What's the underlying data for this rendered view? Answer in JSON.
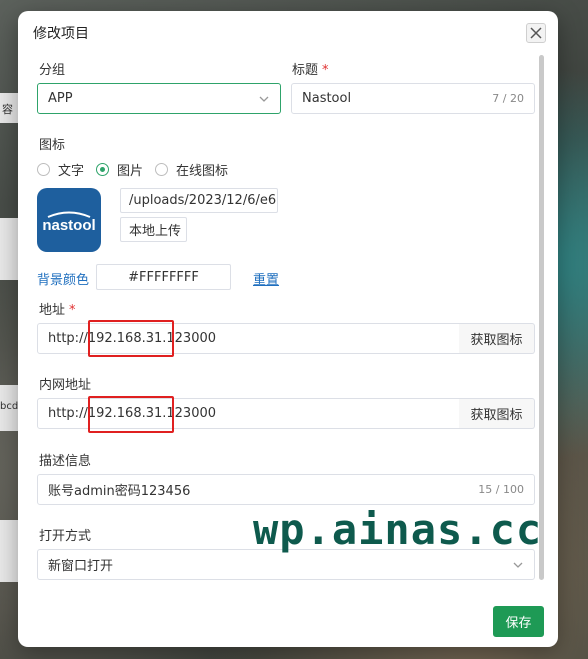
{
  "background": {
    "strip_top_text": "容",
    "strip_mid_text": "bcd"
  },
  "dialog": {
    "title": "修改项目",
    "close_icon": "close-icon"
  },
  "group": {
    "label": "分组",
    "value": "APP"
  },
  "title_field": {
    "label": "标题",
    "required_mark": "*",
    "value": "Nastool",
    "counter": "7 / 20"
  },
  "icon": {
    "label": "图标",
    "options": [
      "文字",
      "图片",
      "在线图标"
    ],
    "selected": "图片",
    "logo_text": "nastool",
    "path_value": "/uploads/2023/12/6/e6",
    "upload_label": "本地上传"
  },
  "bg_color": {
    "label": "背景颜色",
    "value": "#FFFFFFFF",
    "reset_label": "重置"
  },
  "address": {
    "label": "地址",
    "required_mark": "*",
    "value": "http://192.168.31.123000",
    "fetch_label": "获取图标"
  },
  "lan_address": {
    "label": "内网地址",
    "value": "http://192.168.31.123000",
    "fetch_label": "获取图标"
  },
  "description": {
    "label": "描述信息",
    "value": "账号admin密码123456",
    "counter": "15 / 100"
  },
  "open_mode": {
    "label": "打开方式",
    "value": "新窗口打开"
  },
  "watermark": "wp.ainas.cc",
  "save_label": "保存",
  "colors": {
    "accent": "#2ea36a",
    "save_button": "#1e9a55",
    "link": "#1f6fbf",
    "highlight": "#e02020",
    "logo_bg": "#1e5f9e"
  }
}
